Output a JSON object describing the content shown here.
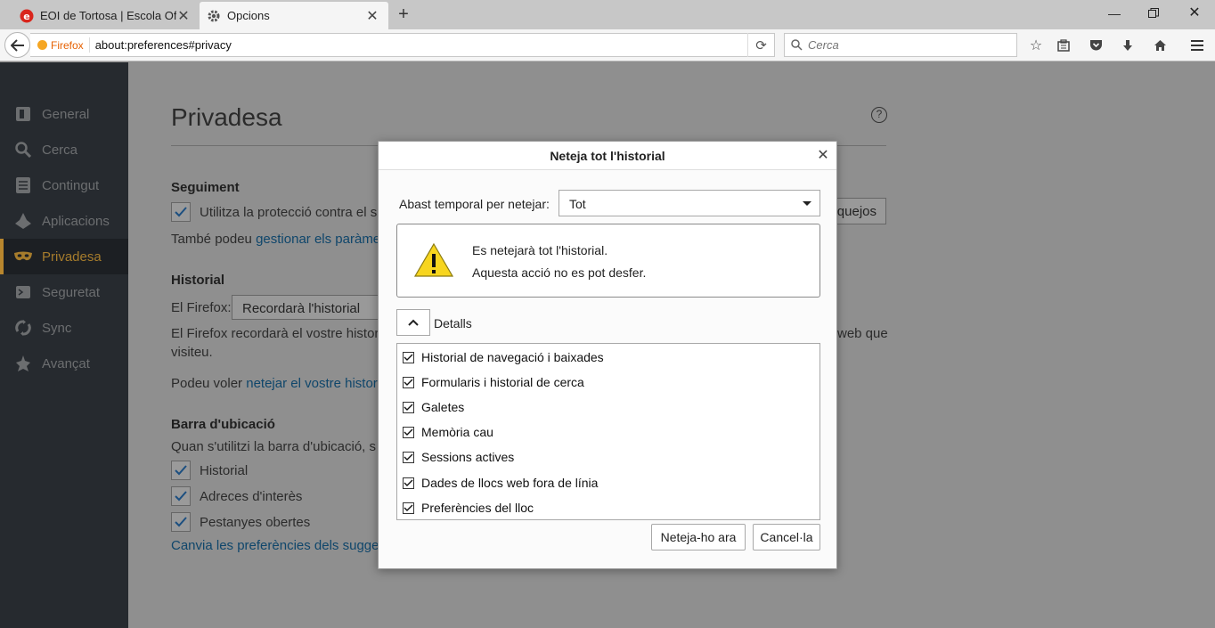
{
  "tabs": [
    {
      "title": "EOI de Tortosa | Escola Ofi...",
      "icon": "eoi-logo-icon"
    },
    {
      "title": "Opcions",
      "icon": "gear-icon"
    }
  ],
  "navbar": {
    "identity": "Firefox",
    "url": "about:preferences#privacy",
    "search_placeholder": "Cerca"
  },
  "sidebar": {
    "items": [
      {
        "label": "General",
        "icon": "general-icon"
      },
      {
        "label": "Cerca",
        "icon": "search-icon"
      },
      {
        "label": "Contingut",
        "icon": "content-icon"
      },
      {
        "label": "Aplicacions",
        "icon": "applications-icon"
      },
      {
        "label": "Privadesa",
        "icon": "privacy-mask-icon"
      },
      {
        "label": "Seguretat",
        "icon": "security-icon"
      },
      {
        "label": "Sync",
        "icon": "sync-icon"
      },
      {
        "label": "Avançat",
        "icon": "advanced-icon"
      }
    ],
    "active": "Privadesa"
  },
  "main": {
    "title": "Privadesa",
    "tracking": {
      "heading": "Seguiment",
      "checkbox_label": "Utilitza la protecció contra el s",
      "also_text": "També podeu ",
      "also_link": "gestionar els paràme",
      "exceptions_button": "quejos"
    },
    "history": {
      "heading": "Historial",
      "firefox_label": "El Firefox:",
      "dropdown_value": "Recordarà l'historial",
      "desc_line1": "El Firefox recordarà el vostre histori",
      "desc_line1_tail": "web que",
      "desc_line2": "visiteu.",
      "clear_prefix": "Podeu voler ",
      "clear_link": "netejar el vostre histori"
    },
    "location_bar": {
      "heading": "Barra d'ubicació",
      "desc": "Quan s'utilitzi la barra d'ubicació, s",
      "options": [
        "Historial",
        "Adreces d'interès",
        "Pestanyes obertes"
      ],
      "link": "Canvia les preferències dels sugger"
    }
  },
  "dialog": {
    "title": "Neteja tot l'historial",
    "range_label": "Abast temporal per netejar:",
    "range_value": "Tot",
    "warning_line1": "Es netejarà tot l'historial.",
    "warning_line2": "Aquesta acció no es pot desfer.",
    "details_label": "Detalls",
    "items": [
      "Historial de navegació i baixades",
      "Formularis i historial de cerca",
      "Galetes",
      "Memòria cau",
      "Sessions actives",
      "Dades de llocs web fora de línia",
      "Preferències del lloc"
    ],
    "clear_button": "Neteja-ho ara",
    "cancel_button": "Cancel·la"
  }
}
